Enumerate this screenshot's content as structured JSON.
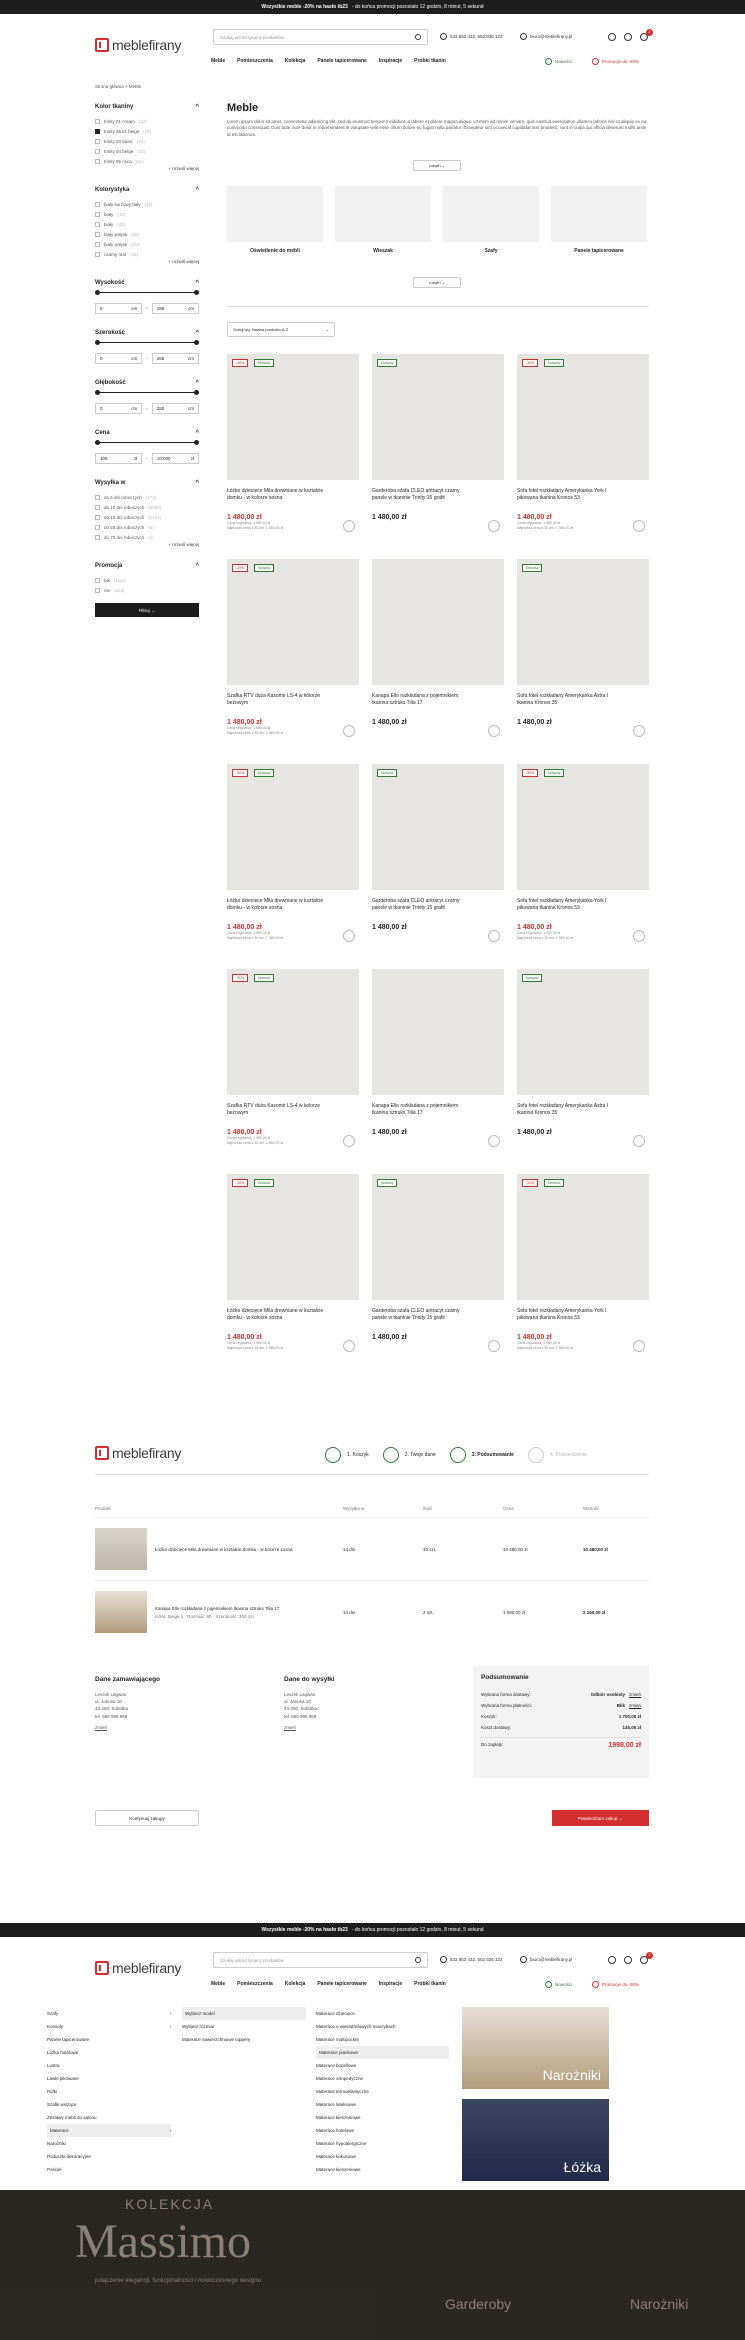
{
  "topbar": {
    "bold": "Wszystkie meble -20% na hasło tb23",
    "rest": "- do końca promocji pozostało 12 godzin, 8 minut, 5 sekund"
  },
  "header": {
    "logo": "meblefirany",
    "search_placeholder": "Szukaj wśród tysięcy produktów",
    "phone": "533 853 432, 502 036 122",
    "email": "biuro@meblefirany.pl"
  },
  "nav": {
    "items": [
      "Meble",
      "Pomieszczenia",
      "Kolekcja",
      "Panele tapicerowane",
      "Inspiracje",
      "Próbki tkanin"
    ],
    "new_label": "Nowości",
    "promo_label": "Promocje do -50%",
    "cart_count": "2"
  },
  "breadcrumb": "Strona główna  >  Meble",
  "filters": {
    "color_title": "Kolor tkaniny",
    "colors": [
      {
        "label": "trinity 01 cream",
        "count": "(42)",
        "on": false
      },
      {
        "label": "trinity 25 ld. beige",
        "count": "(42)",
        "on": true
      },
      {
        "label": "trinity 03 basic",
        "count": "(42)",
        "on": false
      },
      {
        "label": "trinity 04 beige",
        "count": "(42)",
        "on": false
      },
      {
        "label": "trinity 05 mica",
        "count": "(42)",
        "on": false
      }
    ],
    "more": "+ rozwiń więcej",
    "coll_title": "Kolorystyka",
    "colls": [
      {
        "label": "biały kurzowy bały",
        "count": "(42)"
      },
      {
        "label": "biały",
        "count": "(42)"
      },
      {
        "label": "biały",
        "count": "(42)"
      },
      {
        "label": "biały połysk",
        "count": "(42)"
      },
      {
        "label": "biały połysk",
        "count": "(42)"
      },
      {
        "label": "czarny mat",
        "count": "(42)"
      }
    ],
    "height_title": "Wysokość",
    "height_min": "0",
    "height_max": "195",
    "unit": "cm",
    "width_title": "Szerokość",
    "width_min": "0",
    "width_max": "265",
    "depth_title": "Głębokość",
    "depth_min": "0",
    "depth_max": "250",
    "price_title": "Cena",
    "price_min": "100",
    "price_max": "10 000",
    "price_unit": "zł",
    "ship_title": "Wysyłka w",
    "ships": [
      {
        "label": "do 5 dni roboczych",
        "count": "(171)"
      },
      {
        "label": "do 10 dni roboczych",
        "count": "(2083)"
      },
      {
        "label": "do 15 dni roboczych",
        "count": "(1123)"
      },
      {
        "label": "do 25 dni roboczych",
        "count": "(5)"
      },
      {
        "label": "do 70 dni roboczych",
        "count": "(1)"
      }
    ],
    "promo_title": "Promocja",
    "promos": [
      {
        "label": "tak",
        "count": "(1111)"
      },
      {
        "label": "nie",
        "count": "(223)"
      }
    ],
    "filter_btn": "Filtruj"
  },
  "main": {
    "title": "Meble",
    "description": "Lorem ipsum dolor sit amet, consectetur adipiscing elit, sed do eiusmod tempor incididunt ut labore et dolore magna aliqua. Ut enim ad minim veniam, quis nostrud exercitation ullamco laboris nisi ut aliquip ex ea commodo consequat. Duis aute irure dolor in reprehenderit in voluptate velit esse cillum dolore eu fugiat nulla pariatur. Excepteur sint occaecat cupidatat non proident, sunt in culpa qui officia deserunt mollit anim id est laborum.",
    "expand": "rozwiń",
    "sort": "Sortuj wg: Nazwa produktu A-Z"
  },
  "categories": [
    {
      "label": "Oświetlenie do mebli"
    },
    {
      "label": "Wieszak"
    },
    {
      "label": "Szafy"
    },
    {
      "label": "Panele tapicerowane"
    }
  ],
  "products": [
    {
      "name": "Łóżko dziecięce Mila drewniane w kształcie domku - w kolorze sosna",
      "price": "1 480,00 zł",
      "sale": true,
      "tags": [
        "-30%",
        "Nowość"
      ],
      "ph": "ph1",
      "r1": "Cena regularna: 1 980,00 zł",
      "r2": "Najniższa cena z 30 dni: 1 580,00 zł"
    },
    {
      "name": "Garderoba szafa CLEO antracyt czarny panele w tkaninie Trinity 15 grafit",
      "price": "1 480,00 zł",
      "sale": false,
      "tags": [
        "Nowość"
      ],
      "ph": "ph2"
    },
    {
      "name": "Sofa fotel rozkładany Amerykanka York I pikowana tkanina Kronos 53",
      "price": "1 480,00 zł",
      "sale": true,
      "tags": [
        "-30%",
        "Nowość"
      ],
      "ph": "ph3",
      "r1": "Cena regularna: 1 980,00 zł",
      "r2": "Najniższa cena z 30 dni: 1 580,00 zł"
    },
    {
      "name": "Szafka RTV duża Kasomir LS-4 w kolorze beżowym",
      "price": "1 480,00 zł",
      "sale": true,
      "tags": [
        "-30%",
        "Nowość"
      ],
      "ph": "ph4",
      "r1": "Cena regularna: 1 980,00 zł",
      "r2": "Najniższa cena z 30 dni: 1 580,00 zł"
    },
    {
      "name": "Kanapa Ello rozkładana z pojemnikiem tkanina sztruks Tilia 17",
      "price": "1 480,00 zł",
      "sale": false,
      "tags": [],
      "ph": "ph5"
    },
    {
      "name": "Sofa fotel rozkładany Amerykanka Astra I tkanina Kronos 35",
      "price": "1 480,00 zł",
      "sale": false,
      "tags": [
        "Nowość"
      ],
      "ph": "ph6"
    }
  ],
  "checkout": {
    "steps": [
      "1. Koszyk",
      "2. Twoje dane",
      "3. Podsumowanie",
      "4. Potwierdzenie"
    ],
    "cols": [
      "Produkt",
      "Wysyłka w",
      "Ilość",
      "Cena",
      "Wartość"
    ],
    "rows": [
      {
        "name": "Łóżko dziecięce Mila drewniane w kształcie domku - w kolorze sosna",
        "ship": "14 dni",
        "qty": "10 szt.",
        "price": "10 480,00 zł",
        "val": "10 480,00 zł"
      },
      {
        "name": "Kanapa Ello rozkładana z pojemnikiem tkanina sztruks Tilia 17",
        "ship": "14 dni",
        "qty": "2 szt.",
        "price": "1 080,00 zł",
        "val": "2 160,00 zł",
        "detail": "Kolor: Beige 1 · Rozmiar: 80 · Szerokość: 200 cm"
      }
    ],
    "buyer_title": "Dane zamawiającego",
    "buyer": [
      "Leszek Lagwan",
      "ul. Janusa 10",
      "43-250, Sobótka",
      "tel. 660 996 968"
    ],
    "buyer_link": "zmień",
    "ship_title": "Dane do wysyłki",
    "ship": [
      "Leszek Lagwan",
      "ul. Janusa 10",
      "43-250, Sobótka",
      "tel. 660 996 968"
    ],
    "ship_link": "zmień",
    "sum_title": "Podsumowanie",
    "sum_rows": [
      {
        "k": "Wybrana forma dostawy:",
        "v": "Odbiór osobisty"
      },
      {
        "k": "Wybrana forma płatności:",
        "v": "Blik"
      },
      {
        "k": "Koszyk:",
        "v": "1 700,00 zł"
      },
      {
        "k": "Koszt dostawy:",
        "v": "145,00 zł"
      }
    ],
    "total_k": "Do zapłaty:",
    "total_v": "1998,00 zł",
    "zmien": "zmień",
    "back": "Kontynuuj zakupy",
    "confirm": "Potwierdzam zakup"
  },
  "menu": {
    "col1": [
      "Szafy",
      "Konsoly",
      "Panele tapicerowane",
      "Łóżka hotelowe",
      "Lustra",
      "Ławki pikowane",
      "Pufki",
      "Szafki wiszące",
      "Zestawy mebli do salonu",
      "Materace",
      "Narożniki",
      "Poduszki dekoracyjne",
      "Pościel"
    ],
    "col2": [
      "Wybierz model",
      "Wybierz rozmiar",
      "Materace nawierzchniowe toppery"
    ],
    "col3": [
      "Materace dziecięce",
      "Materace o wielostrefowych muszybach",
      "Materace multipocket",
      "Materace piankowe",
      "Materace bonellowe",
      "Materace ortopedyczne",
      "Materace termoelastyczne",
      "Materace lateksowe",
      "Materace kieszeniowe",
      "Materace hotelowe",
      "Materace hypoalergiczne",
      "Materace kokosowe",
      "Materace kieszeniowe"
    ],
    "promo1": "Narożniki",
    "promo2": "Łóżka",
    "hero_small": "KOLEKCJA",
    "hero_big": "Massimo",
    "hero_sub": "połączenie elegancji, funkcjonalności i nowoczesnego designu",
    "hero_garderoby": "Garderoby",
    "hero_narozniki": "Narożniki"
  }
}
